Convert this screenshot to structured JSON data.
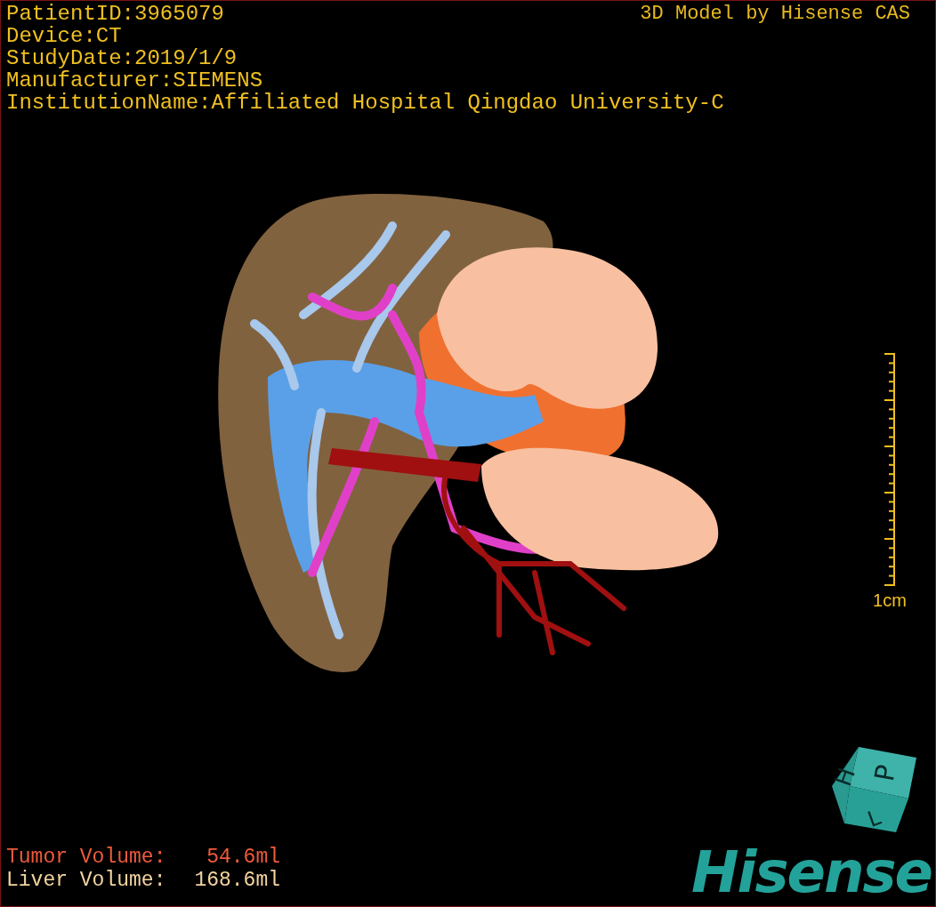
{
  "info_lines": [
    "PatientID:3965079",
    "Device:CT",
    "StudyDate:2019/1/9",
    "Manufacturer:SIEMENS",
    "InstitutionName:Affiliated Hospital Qingdao University-C"
  ],
  "title": "3D Model by Hisense CAS",
  "scale_bar": {
    "label": "1cm"
  },
  "volumes": [
    {
      "label": "Tumor Volume:",
      "value": "54.6ml",
      "color": "#ee5a3c"
    },
    {
      "label": "Liver Volume:",
      "value": "168.6ml",
      "color": "#f3d4a0"
    }
  ],
  "orientation_cube": {
    "faces": [
      "H",
      "P",
      "L"
    ]
  },
  "logo": "Hisense"
}
